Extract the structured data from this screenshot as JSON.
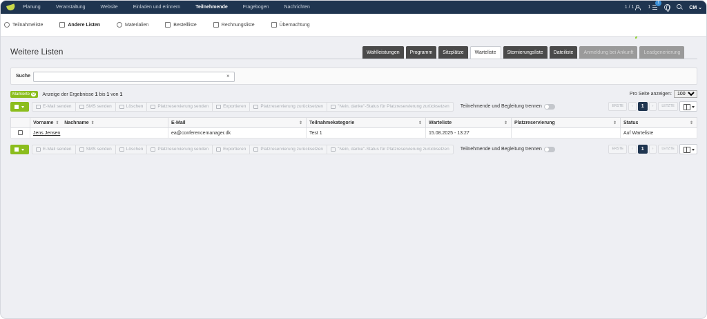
{
  "topnav": {
    "items": [
      "Planung",
      "Veranstaltung",
      "Website",
      "Einladen und erinnern",
      "Teilnehmende",
      "Fragebogen",
      "Nachrichten"
    ],
    "active_index": 4,
    "participant_count": "1 / 1",
    "waitlist_count": "1",
    "waitlist_badge": "1",
    "user_initials": "CM"
  },
  "subnav": {
    "items": [
      "Teilnahmeliste",
      "Andere Listen",
      "Materialien",
      "Bestellliste",
      "Rechnungsliste",
      "Übernachtung"
    ],
    "active_index": 1
  },
  "page": {
    "title": "Weitere Listen"
  },
  "tabs": [
    {
      "label": "Wahlleistungen",
      "state": "normal"
    },
    {
      "label": "Programm",
      "state": "normal"
    },
    {
      "label": "Sitzplätze",
      "state": "normal"
    },
    {
      "label": "Warteliste",
      "state": "active"
    },
    {
      "label": "Stornierungsliste",
      "state": "normal"
    },
    {
      "label": "Dateiliste",
      "state": "normal"
    },
    {
      "label": "Anmeldung bei Ankunft",
      "state": "disabled"
    },
    {
      "label": "Leadgenerierung",
      "state": "disabled"
    }
  ],
  "search": {
    "label": "Suche",
    "value": "",
    "placeholder": "",
    "clear": "×"
  },
  "results": {
    "markierte_label": "Markierte",
    "markierte_count": "0",
    "prefix": "Anzeige der Ergebnisse",
    "from": "1",
    "mid": "bis",
    "to": "1",
    "of_word": "von",
    "total": "1",
    "per_page_label": "Pro Seite anzeigen:",
    "per_page_value": "100"
  },
  "toolbar": {
    "actions": [
      "E-Mail senden",
      "SMS senden",
      "Löschen",
      "Platzreservierung senden",
      "Exportieren",
      "Platzreservierung zurücksetzen",
      "\"Nein, danke\"-Status für Platzreservierung zurücksetzen"
    ],
    "toggle_label": "Teilnehmende und Begleitung trennen",
    "pager": {
      "first": "ERSTE",
      "prev": "‹",
      "current": "1",
      "next": "›",
      "last": "LETZTE"
    }
  },
  "table": {
    "columns": [
      "Vorname",
      "Nachname",
      "E-Mail",
      "Teilnahmekategorie",
      "Warteliste",
      "Platzreservierung",
      "Status"
    ],
    "rows": [
      {
        "vorname": "Jens Jensen",
        "nachname": "",
        "email": "ea@conferencemanager.dk",
        "kategorie": "Test 1",
        "warteliste": "15.08.2025 - 13:27",
        "platz": "",
        "status": "Auf Warteliste"
      }
    ]
  },
  "colors": {
    "navy": "#1f3550",
    "accent_green": "#8bbd1d",
    "tab_dark": "#4a4a4a",
    "badge_blue": "#3b8fd6",
    "annotation_arrow": "#8bd12a"
  }
}
